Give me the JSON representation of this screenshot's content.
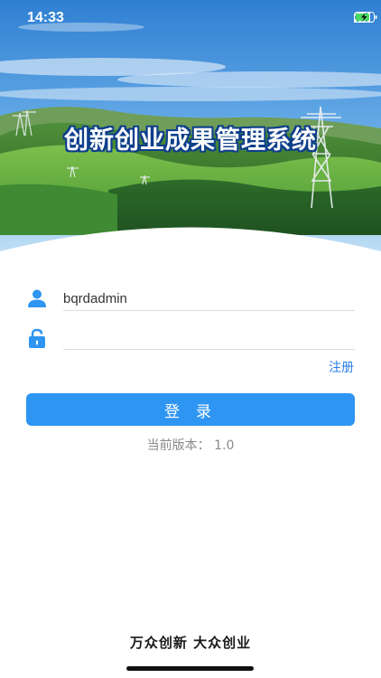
{
  "status_bar": {
    "time": "14:33",
    "icons": [
      "signal-icon",
      "wifi-icon",
      "battery-charging-icon"
    ]
  },
  "hero": {
    "title": "创新创业成果管理系统",
    "colors": {
      "sky": "#3b8bd8",
      "grass": "#5aa23a",
      "title_outline": "#0d3f8a"
    }
  },
  "login_form": {
    "username": {
      "icon": "user-icon",
      "value": "bqrdadmin",
      "placeholder": ""
    },
    "password": {
      "icon": "lock-icon",
      "value": "",
      "placeholder": ""
    },
    "register_label": "注册",
    "login_label": "登录"
  },
  "version": {
    "text": "当前版本：  1.0"
  },
  "footer": {
    "slogan": "万众创新 大众创业"
  },
  "theme": {
    "accent": "#2f95f2",
    "link": "#2b7de9"
  }
}
